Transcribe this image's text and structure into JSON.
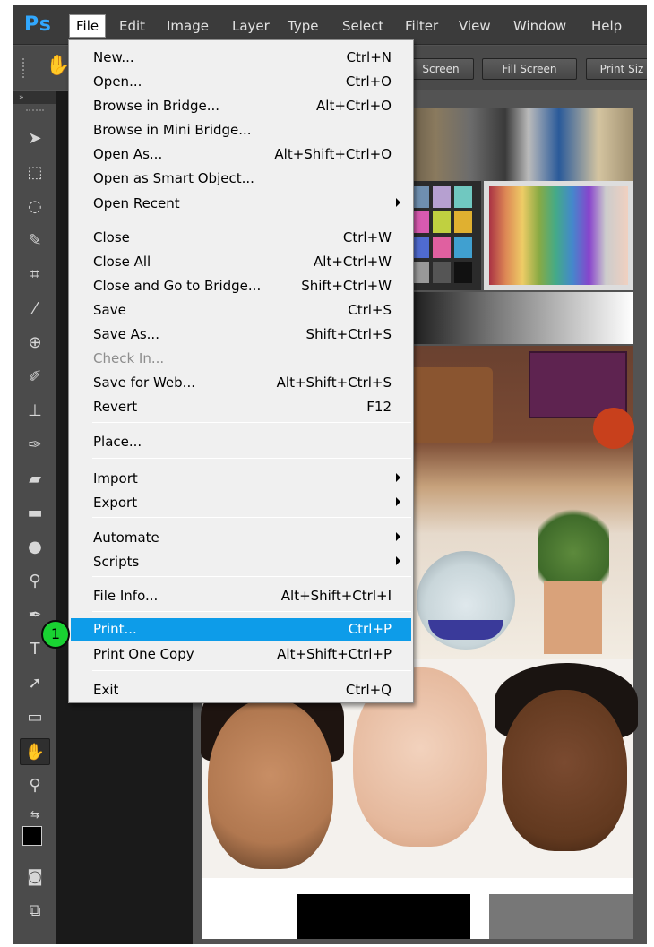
{
  "app": {
    "logo": "Ps"
  },
  "menubar": {
    "items": [
      "File",
      "Edit",
      "Image",
      "Layer",
      "Type",
      "Select",
      "Filter",
      "View",
      "Window",
      "Help"
    ]
  },
  "options_bar": {
    "buttons": [
      "Screen",
      "Fill Screen",
      "Print Siz"
    ]
  },
  "file_menu": {
    "items": [
      {
        "label": "New...",
        "shortcut": "Ctrl+N"
      },
      {
        "label": "Open...",
        "shortcut": "Ctrl+O"
      },
      {
        "label": "Browse in Bridge...",
        "shortcut": "Alt+Ctrl+O"
      },
      {
        "label": "Browse in Mini Bridge...",
        "shortcut": ""
      },
      {
        "label": "Open As...",
        "shortcut": "Alt+Shift+Ctrl+O"
      },
      {
        "label": "Open as Smart Object...",
        "shortcut": ""
      },
      {
        "label": "Open Recent",
        "shortcut": ""
      },
      {
        "label": "Close",
        "shortcut": "Ctrl+W"
      },
      {
        "label": "Close All",
        "shortcut": "Alt+Ctrl+W"
      },
      {
        "label": "Close and Go to Bridge...",
        "shortcut": "Shift+Ctrl+W"
      },
      {
        "label": "Save",
        "shortcut": "Ctrl+S"
      },
      {
        "label": "Save As...",
        "shortcut": "Shift+Ctrl+S"
      },
      {
        "label": "Check In...",
        "shortcut": ""
      },
      {
        "label": "Save for Web...",
        "shortcut": "Alt+Shift+Ctrl+S"
      },
      {
        "label": "Revert",
        "shortcut": "F12"
      },
      {
        "label": "Place...",
        "shortcut": ""
      },
      {
        "label": "Import",
        "shortcut": ""
      },
      {
        "label": "Export",
        "shortcut": ""
      },
      {
        "label": "Automate",
        "shortcut": ""
      },
      {
        "label": "Scripts",
        "shortcut": ""
      },
      {
        "label": "File Info...",
        "shortcut": "Alt+Shift+Ctrl+I"
      },
      {
        "label": "Print...",
        "shortcut": "Ctrl+P"
      },
      {
        "label": "Print One Copy",
        "shortcut": "Alt+Shift+Ctrl+P"
      },
      {
        "label": "Exit",
        "shortcut": "Ctrl+Q"
      }
    ]
  },
  "step_marker": "1",
  "colors": {
    "highlight": "#0d9ce9",
    "step_marker": "#19d232",
    "logo": "#31a8ff"
  }
}
